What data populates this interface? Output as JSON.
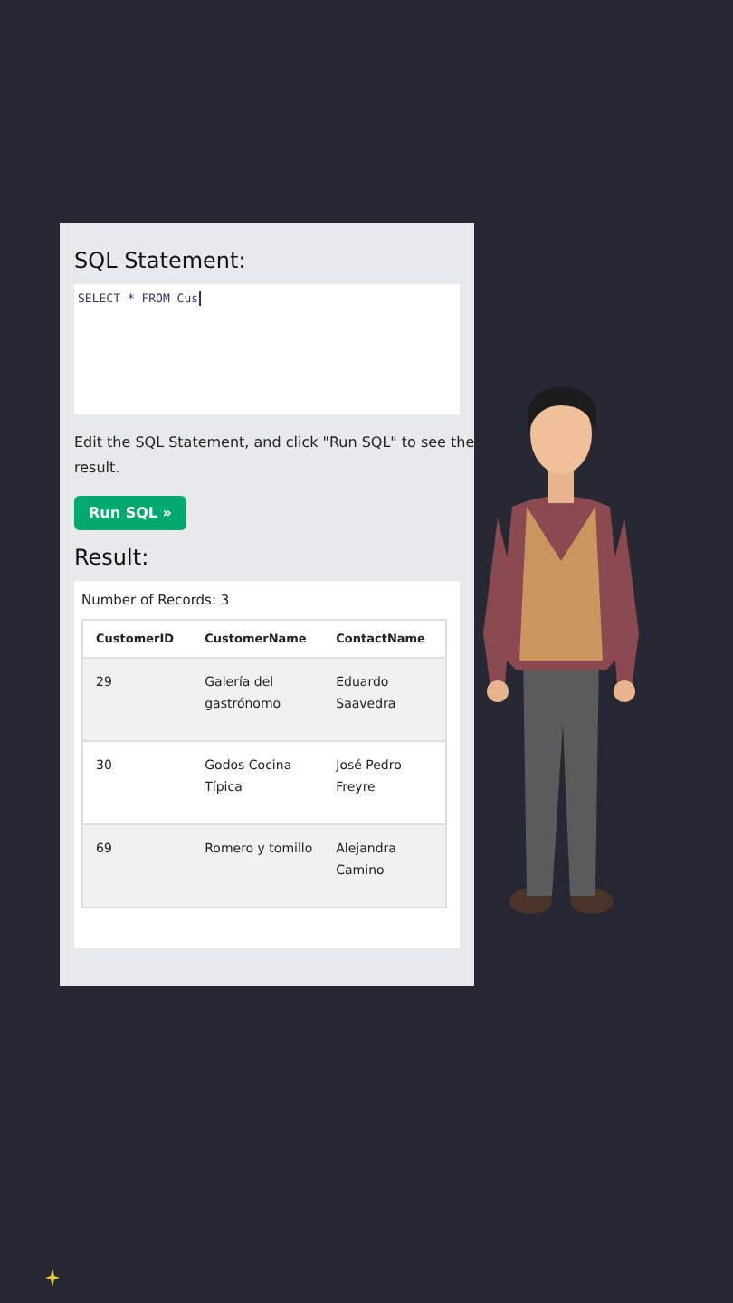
{
  "editor": {
    "heading": "SQL Statement:",
    "query": "SELECT * FROM Cus",
    "hint": "Edit the SQL Statement, and click \"Run SQL\" to see the result.",
    "run_button": "Run SQL »"
  },
  "result": {
    "heading": "Result:",
    "record_count": "Number of Records: 3",
    "columns": [
      "CustomerID",
      "CustomerName",
      "ContactName"
    ],
    "rows": [
      [
        "29",
        "Galería del gastrónomo",
        "Eduardo Saavedra"
      ],
      [
        "30",
        "Godos Cocina Típica",
        "José Pedro Freyre"
      ],
      [
        "69",
        "Romero y tomillo",
        "Alejandra Camino"
      ]
    ]
  }
}
